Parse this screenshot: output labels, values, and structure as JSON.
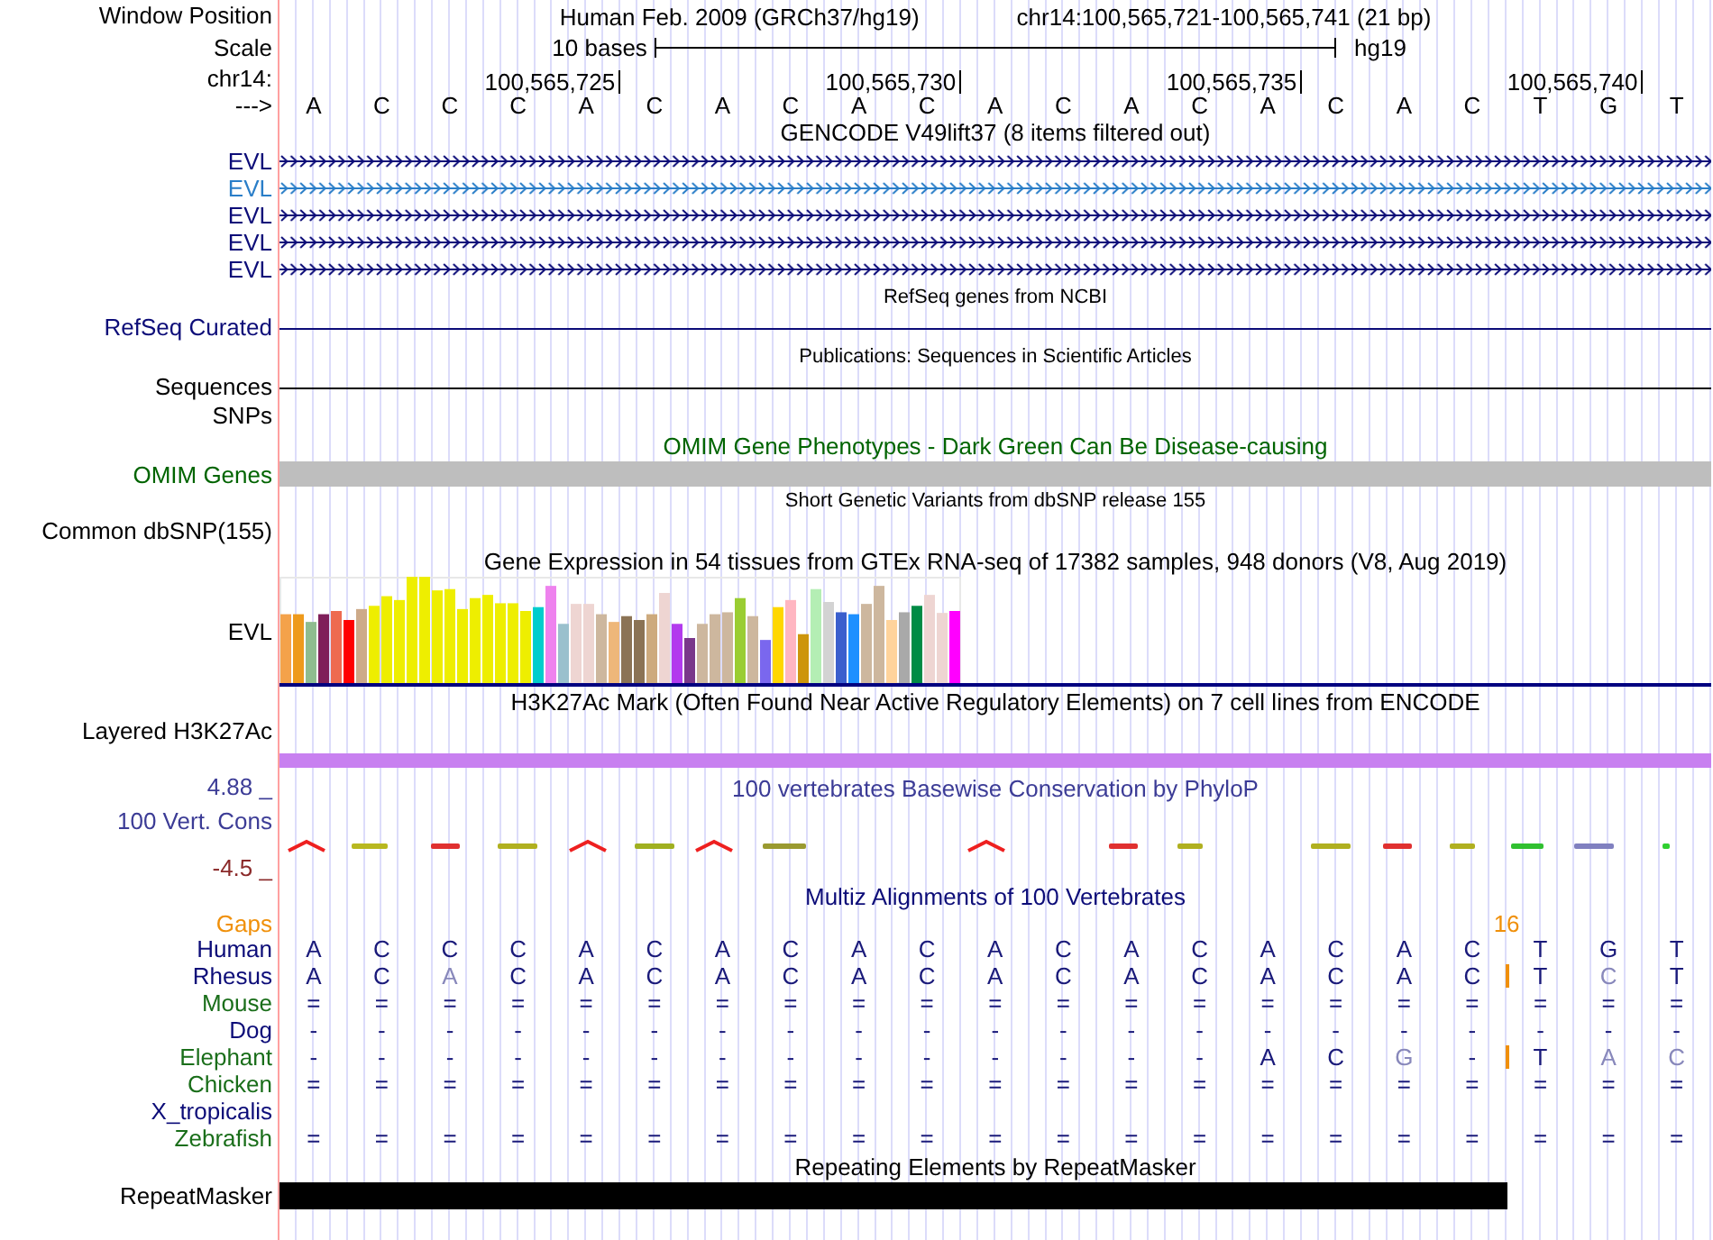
{
  "header": {
    "window_position_label": "Window Position",
    "assembly": "Human Feb. 2009 (GRCh37/hg19)",
    "position": "chr14:100,565,721-100,565,741 (21 bp)",
    "scale_label": "Scale",
    "scale_text": "10 bases",
    "scale_db": "hg19",
    "chrom_label": "chr14:",
    "ticks": [
      "100,565,725",
      "100,565,730",
      "100,565,735",
      "100,565,740"
    ],
    "strand_label": "--->",
    "bases": [
      "A",
      "C",
      "C",
      "C",
      "A",
      "C",
      "A",
      "C",
      "A",
      "C",
      "A",
      "C",
      "A",
      "C",
      "A",
      "C",
      "A",
      "C",
      "T",
      "G",
      "T"
    ]
  },
  "tracks": [
    {
      "title": "GENCODE V49lift37 (8 items filtered out)",
      "small_title": false,
      "color": "#000000",
      "rows": [
        {
          "kind": "gene",
          "label": "EVL",
          "color": "#0c0c78"
        },
        {
          "kind": "gene",
          "label": "EVL",
          "color": "#2a7ec8"
        },
        {
          "kind": "gene",
          "label": "EVL",
          "color": "#0c0c78"
        },
        {
          "kind": "gene",
          "label": "EVL",
          "color": "#0c0c78"
        },
        {
          "kind": "gene",
          "label": "EVL",
          "color": "#0c0c78"
        }
      ]
    },
    {
      "title": "RefSeq genes from NCBI",
      "small_title": true,
      "color": "#000000",
      "rows": [
        {
          "kind": "line",
          "label": "RefSeq Curated",
          "color": "#0c0c78"
        }
      ]
    },
    {
      "title": "Publications: Sequences in Scientific Articles",
      "small_title": true,
      "color": "#000000",
      "rows": [
        {
          "kind": "line",
          "label": "Sequences",
          "color": "#000000"
        },
        {
          "kind": "empty",
          "label": "SNPs",
          "color": "#000000"
        }
      ]
    },
    {
      "title": "OMIM Gene Phenotypes - Dark Green Can Be Disease-causing",
      "small_title": false,
      "color": "#006400",
      "rows": [
        {
          "kind": "bar",
          "label": "OMIM Genes",
          "color": "#006400"
        }
      ]
    },
    {
      "title": "Short Genetic Variants from dbSNP release 155",
      "small_title": true,
      "color": "#000000",
      "rows": [
        {
          "kind": "empty",
          "label": "Common dbSNP(155)",
          "color": "#000000"
        }
      ]
    },
    {
      "title": "Gene Expression in 54 tissues from GTEx RNA-seq of 17382 samples, 948 donors (V8, Aug 2019)",
      "small_title": false,
      "color": "#000000",
      "rows": [
        {
          "kind": "expression",
          "label": "EVL",
          "color": "#000000"
        }
      ]
    },
    {
      "title": "H3K27Ac Mark (Often Found Near Active Regulatory Elements) on 7 cell lines from ENCODE",
      "small_title": false,
      "color": "#000000",
      "rows": [
        {
          "kind": "signal",
          "label": "Layered H3K27Ac",
          "color": "#000000"
        }
      ]
    },
    {
      "title": "100 vertebrates Basewise Conservation by PhyloP",
      "small_title": false,
      "color": "#3c3c96",
      "scale_max": "4.88 _",
      "rows": [
        {
          "kind": "conservation",
          "label": "100 Vert. Cons",
          "color": "#3c3c96",
          "scale_min": "-4.5 _"
        }
      ]
    },
    {
      "title": "Multiz Alignments of 100 Vertebrates",
      "small_title": false,
      "color": "#0c0c78",
      "rows": [
        {
          "kind": "gaps",
          "label": "Gaps",
          "color": "#f0900a",
          "count": "16"
        },
        {
          "kind": "alignment",
          "label": "Human",
          "color": "#0c0c78",
          "insertion": false,
          "cells": [
            "A",
            "C",
            "C",
            "C",
            "A",
            "C",
            "A",
            "C",
            "A",
            "C",
            "A",
            "C",
            "A",
            "C",
            "A",
            "C",
            "A",
            "C",
            "T",
            "G",
            "T"
          ]
        },
        {
          "kind": "alignment",
          "label": "Rhesus",
          "color": "#0c0c78",
          "insertion": true,
          "cells": [
            "A",
            "C",
            "A",
            "C",
            "A",
            "C",
            "A",
            "C",
            "A",
            "C",
            "A",
            "C",
            "A",
            "C",
            "A",
            "C",
            "A",
            "C",
            "T",
            "C",
            "T"
          ],
          "dim": [
            false,
            false,
            true,
            false,
            false,
            false,
            false,
            false,
            false,
            false,
            false,
            false,
            false,
            false,
            false,
            false,
            false,
            false,
            false,
            true,
            false
          ]
        },
        {
          "kind": "alignment",
          "label": "Mouse",
          "color": "#1a6e1a",
          "insertion": false,
          "cells": [
            "=",
            "=",
            "=",
            "=",
            "=",
            "=",
            "=",
            "=",
            "=",
            "=",
            "=",
            "=",
            "=",
            "=",
            "=",
            "=",
            "=",
            "=",
            "=",
            "=",
            "="
          ]
        },
        {
          "kind": "alignment",
          "label": "Dog",
          "color": "#0c0c78",
          "insertion": false,
          "cells": [
            "-",
            "-",
            "-",
            "-",
            "-",
            "-",
            "-",
            "-",
            "-",
            "-",
            "-",
            "-",
            "-",
            "-",
            "-",
            "-",
            "-",
            "-",
            "-",
            "-",
            "-"
          ]
        },
        {
          "kind": "alignment",
          "label": "Elephant",
          "color": "#1a6e1a",
          "insertion": true,
          "cells": [
            "-",
            "-",
            "-",
            "-",
            "-",
            "-",
            "-",
            "-",
            "-",
            "-",
            "-",
            "-",
            "-",
            "-",
            "A",
            "C",
            "G",
            "-",
            "T",
            "A",
            "C"
          ],
          "dim": [
            false,
            false,
            false,
            false,
            false,
            false,
            false,
            false,
            false,
            false,
            false,
            false,
            false,
            false,
            false,
            false,
            true,
            false,
            false,
            true,
            true
          ]
        },
        {
          "kind": "alignment",
          "label": "Chicken",
          "color": "#1a6e1a",
          "insertion": false,
          "cells": [
            "=",
            "=",
            "=",
            "=",
            "=",
            "=",
            "=",
            "=",
            "=",
            "=",
            "=",
            "=",
            "=",
            "=",
            "=",
            "=",
            "=",
            "=",
            "=",
            "=",
            "="
          ]
        },
        {
          "kind": "alignment",
          "label": "X_tropicalis",
          "color": "#0c0c78",
          "insertion": false
        },
        {
          "kind": "alignment",
          "label": "Zebrafish",
          "color": "#1a6e1a",
          "insertion": false,
          "cells": [
            "=",
            "=",
            "=",
            "=",
            "=",
            "=",
            "=",
            "=",
            "=",
            "=",
            "=",
            "=",
            "=",
            "=",
            "=",
            "=",
            "=",
            "=",
            "=",
            "=",
            "="
          ]
        }
      ]
    },
    {
      "title": "Repeating Elements by RepeatMasker",
      "small_title": false,
      "color": "#000000",
      "rows": [
        {
          "kind": "repeat",
          "label": "RepeatMasker",
          "color": "#000000"
        }
      ]
    }
  ]
}
